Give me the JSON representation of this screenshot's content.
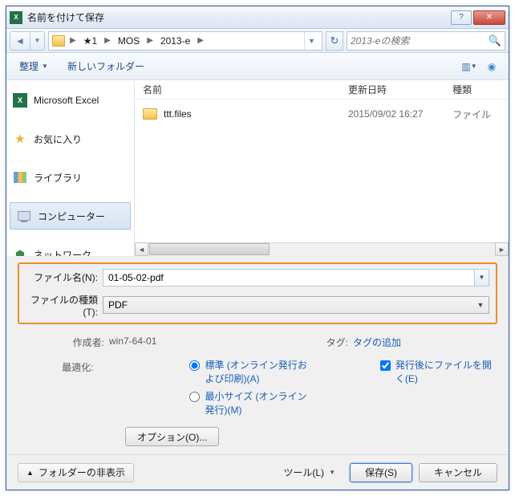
{
  "title": "名前を付けて保存",
  "breadcrumb": {
    "items": [
      "★1",
      "MOS",
      "2013-e"
    ]
  },
  "search": {
    "placeholder": "2013-eの検索"
  },
  "toolbar": {
    "organize": "整理",
    "new_folder": "新しいフォルダー"
  },
  "sidebar": {
    "items": [
      {
        "label": "Microsoft Excel"
      },
      {
        "label": "お気に入り"
      },
      {
        "label": "ライブラリ"
      },
      {
        "label": "コンピューター"
      },
      {
        "label": "ネットワーク"
      }
    ]
  },
  "columns": {
    "name": "名前",
    "date": "更新日時",
    "type": "種類"
  },
  "files": [
    {
      "name": "ttt.files",
      "date": "2015/09/02 16:27",
      "type": "ファイル"
    }
  ],
  "form": {
    "filename_label": "ファイル名(N):",
    "filename_value": "01-05-02-pdf",
    "filetype_label": "ファイルの種類(T):",
    "filetype_value": "PDF"
  },
  "meta": {
    "author_label": "作成者:",
    "author_value": "win7-64-01",
    "tags_label": "タグ:",
    "tags_value": "タグの追加",
    "optimize_label": "最適化:",
    "opt_standard": "標準 (オンライン発行および印刷)(A)",
    "opt_minimum": "最小サイズ (オンライン発行)(M)",
    "open_after": "発行後にファイルを開く(E)",
    "options_btn": "オプション(O)..."
  },
  "footer": {
    "hide_folders": "フォルダーの非表示",
    "tools": "ツール(L)",
    "save": "保存(S)",
    "cancel": "キャンセル"
  }
}
